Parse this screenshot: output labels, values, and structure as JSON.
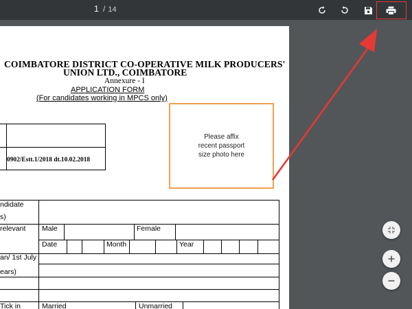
{
  "toolbar": {
    "page_current": "1",
    "page_separator": "/",
    "page_total": "14",
    "icons": [
      "rotate-clockwise-icon",
      "rotate-counterclockwise-icon",
      "save-icon",
      "print-icon"
    ]
  },
  "document": {
    "header_line1": "COIMBATORE DISTRICT CO-OPERATIVE MILK PRODUCERS'",
    "header_line2": "UNION LTD., COIMBATORE",
    "annexure": "Annexure - I",
    "form_title": "APPLICATION FORM",
    "form_subtitle": "(For candidates working in MPCS only)",
    "reference": "0902/Estt.1/2018 dt.10.02.2018",
    "photo_box": {
      "line1": "Please affix",
      "line2": "recent passport",
      "line3": "size photo here"
    },
    "form_rows": {
      "candidate_fragment": "ndidate",
      "candidate_fragment2": "s)",
      "relevant_fragment": "relevant",
      "male_label": "Male",
      "female_label": "Female",
      "date_label": "Date",
      "month_label": "Month",
      "year_label": "Year",
      "july_fragment": "an/ 1st July",
      "years_fragment": "ears)",
      "tick_fragment": "Tick in",
      "married_label": "Married",
      "unmarried_label": "Unmarried"
    }
  },
  "viewer_controls": {
    "icons": [
      "fit-to-page-icon",
      "zoom-in-icon",
      "zoom-out-icon"
    ]
  },
  "colors": {
    "toolbar": "#323639",
    "background": "#525659",
    "annotation_red": "#e53935",
    "photo_border": "#f0a050"
  }
}
